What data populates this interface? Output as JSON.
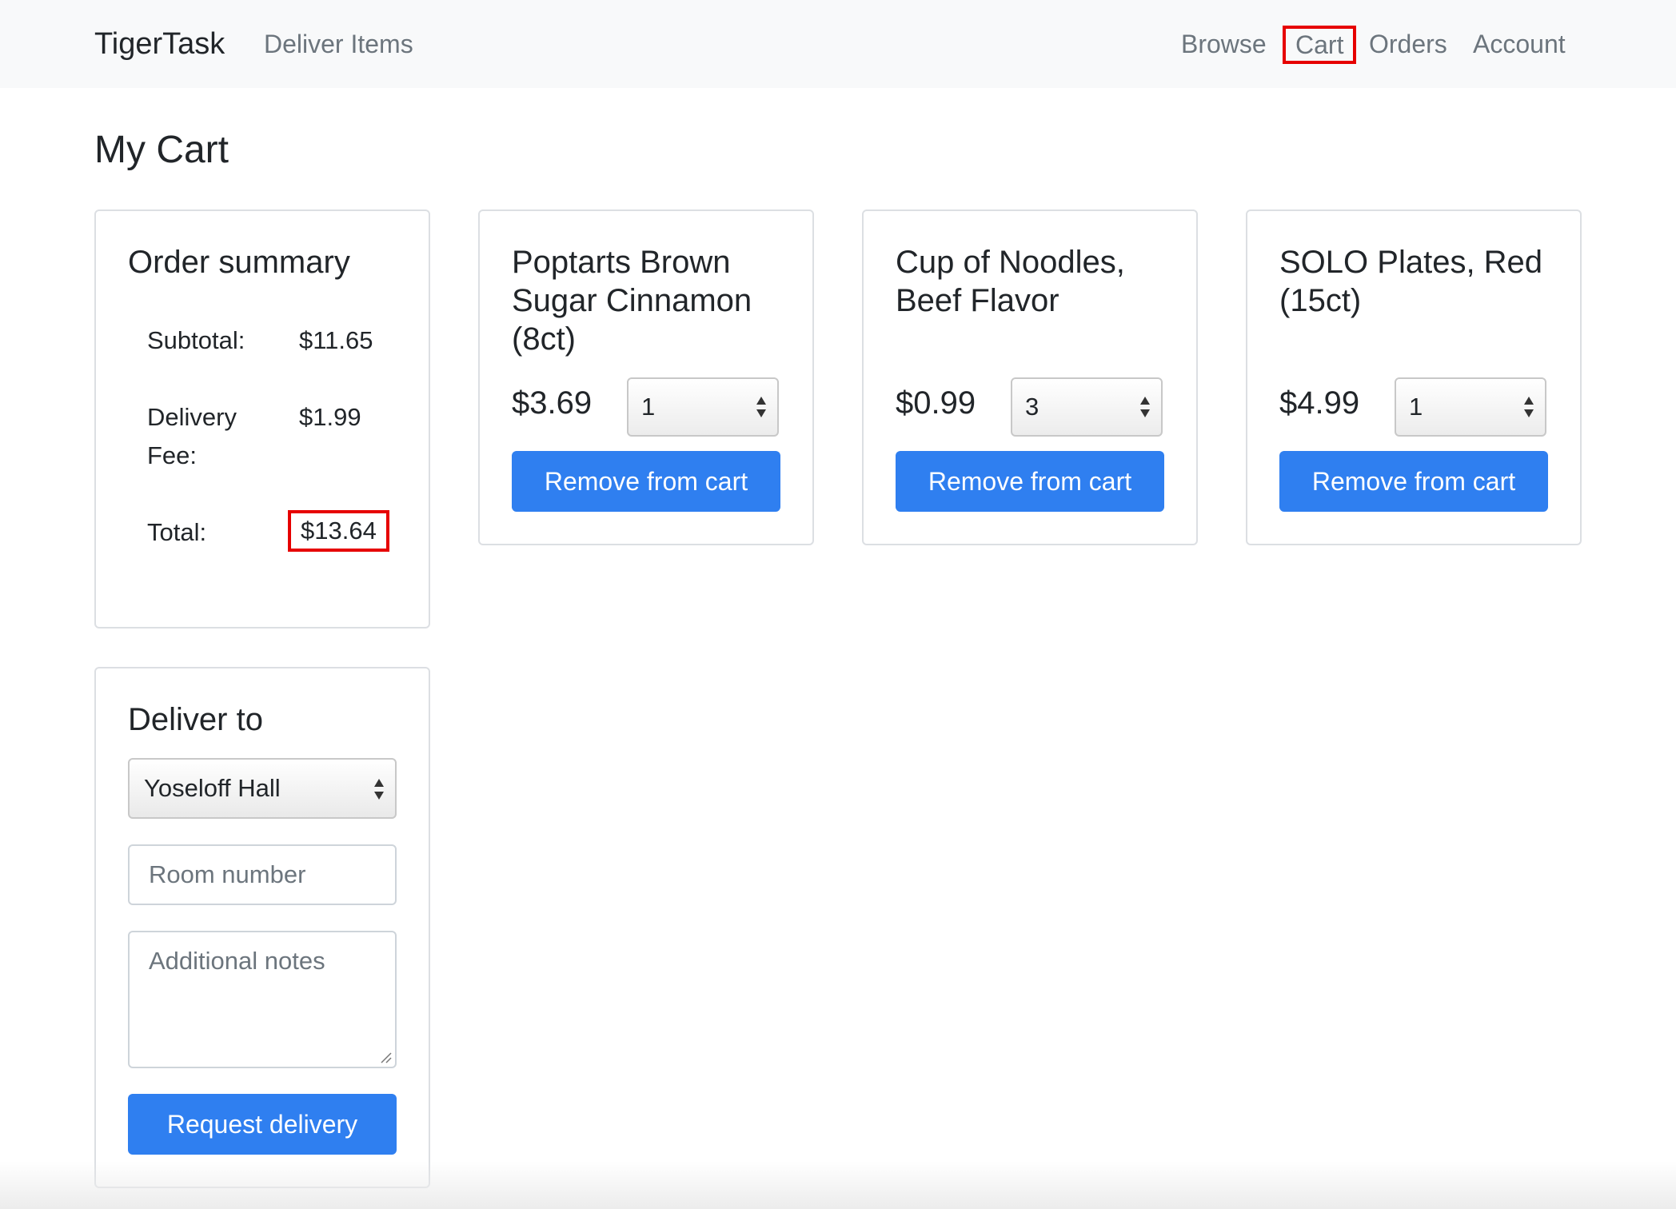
{
  "nav": {
    "brand": "TigerTask",
    "deliver_items": "Deliver Items",
    "browse": "Browse",
    "cart": "Cart",
    "orders": "Orders",
    "account": "Account"
  },
  "page": {
    "title": "My Cart"
  },
  "summary": {
    "title": "Order summary",
    "subtotal_label": "Subtotal:",
    "subtotal_value": "$11.65",
    "fee_label": "Delivery Fee:",
    "fee_value": "$1.99",
    "total_label": "Total:",
    "total_value": "$13.64"
  },
  "items": [
    {
      "name": "Poptarts Brown Sugar Cinnamon (8ct)",
      "price": "$3.69",
      "quantity": "1",
      "remove_label": "Remove from cart"
    },
    {
      "name": "Cup of Noodles, Beef Flavor",
      "price": "$0.99",
      "quantity": "3",
      "remove_label": "Remove from cart"
    },
    {
      "name": "SOLO Plates, Red (15ct)",
      "price": "$4.99",
      "quantity": "1",
      "remove_label": "Remove from cart"
    }
  ],
  "delivery": {
    "title": "Deliver to",
    "location": "Yoseloff Hall",
    "room_placeholder": "Room number",
    "notes_placeholder": "Additional notes",
    "request_label": "Request delivery"
  },
  "colors": {
    "primary": "#2f7ff0",
    "highlight": "#e60000",
    "navbar_bg": "#f8f9fa"
  }
}
